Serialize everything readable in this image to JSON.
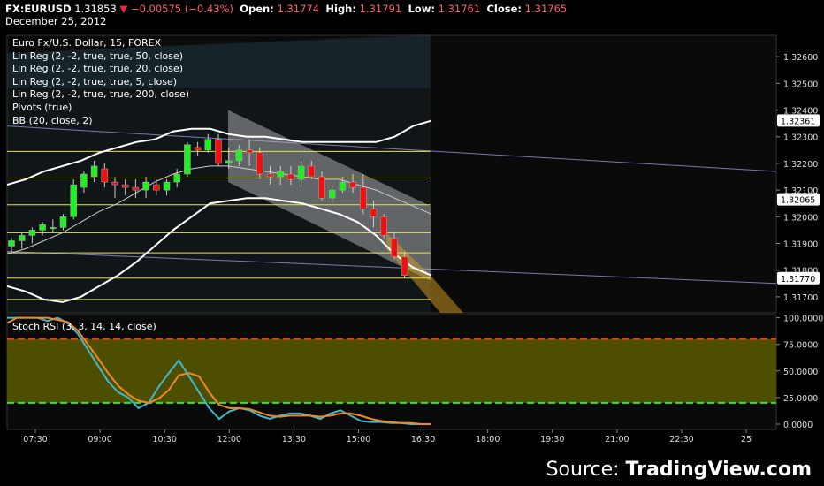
{
  "header": {
    "symbol": "FX:EURUSD",
    "last": "1.31853",
    "arrow": "▼",
    "change": "−0.00575 (−0.43%)",
    "open_label": "Open:",
    "open": "1.31774",
    "high_label": "High:",
    "high": "1.31791",
    "low_label": "Low:",
    "low": "1.31761",
    "close_label": "Close:",
    "close": "1.31765",
    "date": "December 25, 2012"
  },
  "legend": [
    "Euro Fx/U.S. Dollar, 15, FOREX",
    "Lin Reg (2, -2, true, true, 50, close)",
    "Lin Reg (2, -2, true, true, 20, close)",
    "Lin Reg (2, -2, true, true, 5, close)",
    "Lin Reg (2, -2, true, true, 200, close)",
    "Pivots (true)",
    "BB (20, close, 2)"
  ],
  "stoch_title": "Stoch RSI (3, 3, 14, 14, close)",
  "source": {
    "prefix": "Source: ",
    "brand": "TradingView.com"
  },
  "colors": {
    "up": "#22ee22",
    "down": "#ee1111",
    "bb": "#ffffff",
    "pivot": "#e6e64a",
    "stoch_k": "#3fb8d0",
    "stoch_d": "#f08a20",
    "stoch_upper": "#ff3a10",
    "stoch_lower": "#22ee22",
    "stoch_band": "#5a5a00"
  },
  "chart_data": [
    {
      "type": "candlestick",
      "title": "",
      "y_ticks": [
        "1.32600",
        "1.32500",
        "1.32400",
        "1.32300",
        "1.32200",
        "1.32100",
        "1.32000",
        "1.31900",
        "1.31800",
        "1.31700"
      ],
      "ylim": [
        1.3164,
        1.3268
      ],
      "x_ticks": [
        "07:30",
        "09:00",
        "10:30",
        "12:00",
        "13:30",
        "15:00",
        "16:30",
        "18:00",
        "19:30",
        "21:00",
        "22:30",
        "25"
      ],
      "price_labels": [
        {
          "value": 1.32361,
          "text": "1.32361"
        },
        {
          "value": 1.32065,
          "text": "1.32065"
        },
        {
          "value": 1.3177,
          "text": "1.31770"
        }
      ],
      "pivot_levels": [
        1.32245,
        1.32145,
        1.32045,
        1.3194,
        1.31865,
        1.3177,
        1.3169
      ],
      "candles": [
        [
          1.3189,
          1.3192,
          1.3186,
          1.3191
        ],
        [
          1.3191,
          1.3194,
          1.3188,
          1.3193
        ],
        [
          1.3193,
          1.3196,
          1.319,
          1.3195
        ],
        [
          1.3195,
          1.3198,
          1.3193,
          1.3197
        ],
        [
          1.3196,
          1.3199,
          1.3194,
          1.3196
        ],
        [
          1.3196,
          1.3201,
          1.3195,
          1.32
        ],
        [
          1.32,
          1.3214,
          1.3199,
          1.3212
        ],
        [
          1.3211,
          1.3217,
          1.3209,
          1.3216
        ],
        [
          1.3215,
          1.3221,
          1.3213,
          1.3219
        ],
        [
          1.3218,
          1.322,
          1.3211,
          1.3213
        ],
        [
          1.3213,
          1.3215,
          1.3207,
          1.3212
        ],
        [
          1.3212,
          1.3214,
          1.3208,
          1.3211
        ],
        [
          1.3211,
          1.3214,
          1.3207,
          1.321
        ],
        [
          1.321,
          1.3215,
          1.3207,
          1.3213
        ],
        [
          1.3212,
          1.3214,
          1.3208,
          1.321
        ],
        [
          1.321,
          1.3214,
          1.3208,
          1.3213
        ],
        [
          1.3213,
          1.3218,
          1.3211,
          1.3216
        ],
        [
          1.3216,
          1.3228,
          1.3215,
          1.3227
        ],
        [
          1.3226,
          1.3228,
          1.3223,
          1.3225
        ],
        [
          1.3225,
          1.3231,
          1.3224,
          1.3229
        ],
        [
          1.3229,
          1.3231,
          1.3219,
          1.322
        ],
        [
          1.322,
          1.3226,
          1.3218,
          1.3221
        ],
        [
          1.3221,
          1.3227,
          1.3219,
          1.3225
        ],
        [
          1.3225,
          1.3229,
          1.3219,
          1.3224
        ],
        [
          1.3224,
          1.3226,
          1.3214,
          1.3216
        ],
        [
          1.3216,
          1.3219,
          1.3212,
          1.3215
        ],
        [
          1.3215,
          1.3219,
          1.3212,
          1.3217
        ],
        [
          1.3216,
          1.3219,
          1.3212,
          1.3214
        ],
        [
          1.3214,
          1.3221,
          1.3211,
          1.3219
        ],
        [
          1.3219,
          1.3221,
          1.3214,
          1.3215
        ],
        [
          1.3215,
          1.3217,
          1.3206,
          1.3207
        ],
        [
          1.3207,
          1.3212,
          1.3205,
          1.321
        ],
        [
          1.321,
          1.3215,
          1.3209,
          1.3213
        ],
        [
          1.3213,
          1.3216,
          1.3209,
          1.3211
        ],
        [
          1.3211,
          1.3216,
          1.3201,
          1.3203
        ],
        [
          1.3203,
          1.3206,
          1.3196,
          1.32
        ],
        [
          1.32,
          1.3201,
          1.3192,
          1.3193
        ],
        [
          1.3192,
          1.3194,
          1.3184,
          1.3185
        ],
        [
          1.3185,
          1.3187,
          1.3177,
          1.3178
        ]
      ],
      "bb_upper": [
        1.3212,
        1.3214,
        1.3217,
        1.3219,
        1.3221,
        1.3224,
        1.3226,
        1.3228,
        1.3229,
        1.3232,
        1.3233,
        1.3233,
        1.3231,
        1.323,
        1.323,
        1.3229,
        1.3228,
        1.3228,
        1.3228,
        1.3228,
        1.3228,
        1.323,
        1.3234,
        1.3236
      ],
      "bb_middle": [
        1.3186,
        1.3188,
        1.3191,
        1.3194,
        1.3198,
        1.3202,
        1.3205,
        1.3209,
        1.3213,
        1.3216,
        1.3218,
        1.3219,
        1.3219,
        1.3218,
        1.3217,
        1.3216,
        1.3215,
        1.3214,
        1.3214,
        1.3212,
        1.321,
        1.3207,
        1.3204,
        1.3201
      ],
      "bb_lower": [
        1.3174,
        1.3172,
        1.3169,
        1.3168,
        1.317,
        1.3174,
        1.3178,
        1.3183,
        1.3189,
        1.3195,
        1.32,
        1.3205,
        1.3206,
        1.3207,
        1.3207,
        1.3206,
        1.3205,
        1.3203,
        1.3201,
        1.3198,
        1.3193,
        1.3186,
        1.3181,
        1.3178
      ]
    },
    {
      "type": "line",
      "title": "Stoch RSI (3, 3, 14, 14, close)",
      "y_ticks": [
        "100.0000",
        "75.0000",
        "50.0000",
        "25.0000",
        "0.0000"
      ],
      "ylim": [
        -5,
        103
      ],
      "upper_band": 80,
      "lower_band": 20,
      "series": [
        {
          "name": "",
          "values": [
            100,
            100,
            100,
            100,
            97,
            100,
            95,
            85,
            70,
            55,
            40,
            30,
            25,
            15,
            20,
            35,
            48,
            60,
            45,
            30,
            15,
            5,
            12,
            15,
            13,
            8,
            5,
            8,
            10,
            10,
            8,
            5,
            10,
            13,
            8,
            3,
            2,
            2,
            1,
            1,
            0,
            0,
            0
          ]
        },
        {
          "name": "",
          "values": [
            95,
            100,
            100,
            100,
            100,
            98,
            96,
            88,
            75,
            62,
            48,
            36,
            28,
            22,
            20,
            24,
            32,
            46,
            48,
            45,
            30,
            18,
            15,
            15,
            14,
            11,
            8,
            7,
            8,
            8,
            8,
            7,
            8,
            10,
            10,
            8,
            5,
            3,
            2,
            1,
            1,
            0,
            0
          ]
        }
      ]
    }
  ]
}
